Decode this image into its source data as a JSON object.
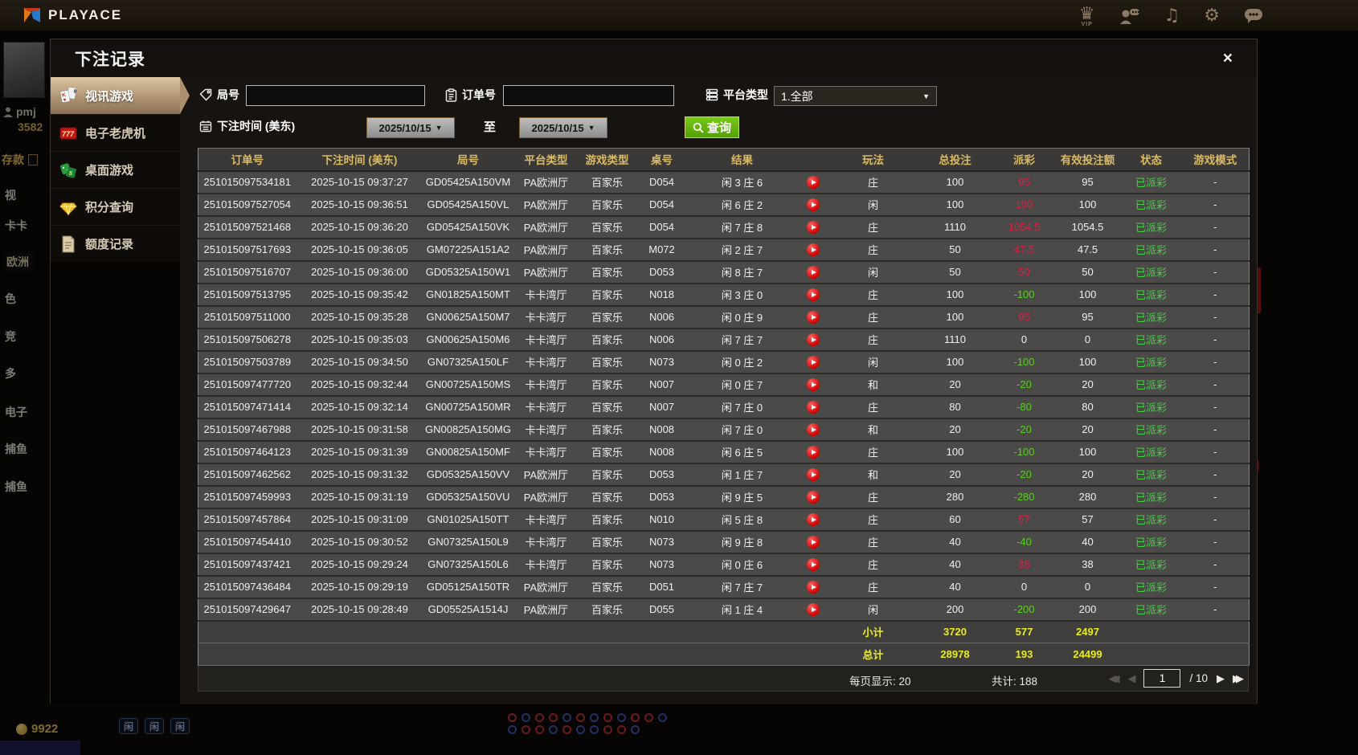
{
  "app": {
    "brand": "PLAYACE"
  },
  "modal": {
    "title": "下注记录",
    "close_glyph": "×"
  },
  "sidebar": {
    "items": [
      {
        "label": "视讯游戏",
        "active": true
      },
      {
        "label": "电子老虎机",
        "active": false
      },
      {
        "label": "桌面游戏",
        "active": false
      },
      {
        "label": "积分查询",
        "active": false
      },
      {
        "label": "额度记录",
        "active": false
      }
    ]
  },
  "filters": {
    "round_label": "局号",
    "round_value": "",
    "order_label": "订单号",
    "order_value": "",
    "platform_label": "平台类型",
    "platform_value": "1.全部",
    "time_label": "下注时间 (美东)",
    "date_from": "2025/10/15",
    "to_label": "至",
    "date_to": "2025/10/15",
    "query_label": "查询",
    "caret": "▼"
  },
  "table": {
    "headers": [
      "订单号",
      "下注时间 (美东)",
      "局号",
      "平台类型",
      "游戏类型",
      "桌号",
      "结果",
      "",
      "玩法",
      "总投注",
      "派彩",
      "有效投注额",
      "状态",
      "游戏模式"
    ],
    "rows": [
      {
        "order": "251015097534181",
        "time": "2025-10-15 09:37:27",
        "round": "GD05425A150VM",
        "platform": "PA欧洲厅",
        "game": "百家乐",
        "table": "D054",
        "result": "闲 3 庄 6",
        "play": "庄",
        "bet": "100",
        "payout": "95",
        "payout_sign": "pos",
        "valid": "95",
        "status": "已派彩",
        "mode": "-"
      },
      {
        "order": "251015097527054",
        "time": "2025-10-15 09:36:51",
        "round": "GD05425A150VL",
        "platform": "PA欧洲厅",
        "game": "百家乐",
        "table": "D054",
        "result": "闲 6 庄 2",
        "play": "闲",
        "bet": "100",
        "payout": "100",
        "payout_sign": "pos",
        "valid": "100",
        "status": "已派彩",
        "mode": "-"
      },
      {
        "order": "251015097521468",
        "time": "2025-10-15 09:36:20",
        "round": "GD05425A150VK",
        "platform": "PA欧洲厅",
        "game": "百家乐",
        "table": "D054",
        "result": "闲 7 庄 8",
        "play": "庄",
        "bet": "1110",
        "payout": "1054.5",
        "payout_sign": "pos",
        "valid": "1054.5",
        "status": "已派彩",
        "mode": "-"
      },
      {
        "order": "251015097517693",
        "time": "2025-10-15 09:36:05",
        "round": "GM07225A151A2",
        "platform": "PA欧洲厅",
        "game": "百家乐",
        "table": "M072",
        "result": "闲 2 庄 7",
        "play": "庄",
        "bet": "50",
        "payout": "47.5",
        "payout_sign": "pos",
        "valid": "47.5",
        "status": "已派彩",
        "mode": "-"
      },
      {
        "order": "251015097516707",
        "time": "2025-10-15 09:36:00",
        "round": "GD05325A150W1",
        "platform": "PA欧洲厅",
        "game": "百家乐",
        "table": "D053",
        "result": "闲 8 庄 7",
        "play": "闲",
        "bet": "50",
        "payout": "50",
        "payout_sign": "pos",
        "valid": "50",
        "status": "已派彩",
        "mode": "-"
      },
      {
        "order": "251015097513795",
        "time": "2025-10-15 09:35:42",
        "round": "GN01825A150MT",
        "platform": "卡卡湾厅",
        "game": "百家乐",
        "table": "N018",
        "result": "闲 3 庄 0",
        "play": "庄",
        "bet": "100",
        "payout": "-100",
        "payout_sign": "neg",
        "valid": "100",
        "status": "已派彩",
        "mode": "-"
      },
      {
        "order": "251015097511000",
        "time": "2025-10-15 09:35:28",
        "round": "GN00625A150M7",
        "platform": "卡卡湾厅",
        "game": "百家乐",
        "table": "N006",
        "result": "闲 0 庄 9",
        "play": "庄",
        "bet": "100",
        "payout": "95",
        "payout_sign": "pos",
        "valid": "95",
        "status": "已派彩",
        "mode": "-"
      },
      {
        "order": "251015097506278",
        "time": "2025-10-15 09:35:03",
        "round": "GN00625A150M6",
        "platform": "卡卡湾厅",
        "game": "百家乐",
        "table": "N006",
        "result": "闲 7 庄 7",
        "play": "庄",
        "bet": "1110",
        "payout": "0",
        "payout_sign": "zero",
        "valid": "0",
        "status": "已派彩",
        "mode": "-"
      },
      {
        "order": "251015097503789",
        "time": "2025-10-15 09:34:50",
        "round": "GN07325A150LF",
        "platform": "卡卡湾厅",
        "game": "百家乐",
        "table": "N073",
        "result": "闲 0 庄 2",
        "play": "闲",
        "bet": "100",
        "payout": "-100",
        "payout_sign": "neg",
        "valid": "100",
        "status": "已派彩",
        "mode": "-"
      },
      {
        "order": "251015097477720",
        "time": "2025-10-15 09:32:44",
        "round": "GN00725A150MS",
        "platform": "卡卡湾厅",
        "game": "百家乐",
        "table": "N007",
        "result": "闲 0 庄 7",
        "play": "和",
        "bet": "20",
        "payout": "-20",
        "payout_sign": "neg",
        "valid": "20",
        "status": "已派彩",
        "mode": "-"
      },
      {
        "order": "251015097471414",
        "time": "2025-10-15 09:32:14",
        "round": "GN00725A150MR",
        "platform": "卡卡湾厅",
        "game": "百家乐",
        "table": "N007",
        "result": "闲 7 庄 0",
        "play": "庄",
        "bet": "80",
        "payout": "-80",
        "payout_sign": "neg",
        "valid": "80",
        "status": "已派彩",
        "mode": "-"
      },
      {
        "order": "251015097467988",
        "time": "2025-10-15 09:31:58",
        "round": "GN00825A150MG",
        "platform": "卡卡湾厅",
        "game": "百家乐",
        "table": "N008",
        "result": "闲 7 庄 0",
        "play": "和",
        "bet": "20",
        "payout": "-20",
        "payout_sign": "neg",
        "valid": "20",
        "status": "已派彩",
        "mode": "-"
      },
      {
        "order": "251015097464123",
        "time": "2025-10-15 09:31:39",
        "round": "GN00825A150MF",
        "platform": "卡卡湾厅",
        "game": "百家乐",
        "table": "N008",
        "result": "闲 6 庄 5",
        "play": "庄",
        "bet": "100",
        "payout": "-100",
        "payout_sign": "neg",
        "valid": "100",
        "status": "已派彩",
        "mode": "-"
      },
      {
        "order": "251015097462562",
        "time": "2025-10-15 09:31:32",
        "round": "GD05325A150VV",
        "platform": "PA欧洲厅",
        "game": "百家乐",
        "table": "D053",
        "result": "闲 1 庄 7",
        "play": "和",
        "bet": "20",
        "payout": "-20",
        "payout_sign": "neg",
        "valid": "20",
        "status": "已派彩",
        "mode": "-"
      },
      {
        "order": "251015097459993",
        "time": "2025-10-15 09:31:19",
        "round": "GD05325A150VU",
        "platform": "PA欧洲厅",
        "game": "百家乐",
        "table": "D053",
        "result": "闲 9 庄 5",
        "play": "庄",
        "bet": "280",
        "payout": "-280",
        "payout_sign": "neg",
        "valid": "280",
        "status": "已派彩",
        "mode": "-"
      },
      {
        "order": "251015097457864",
        "time": "2025-10-15 09:31:09",
        "round": "GN01025A150TT",
        "platform": "卡卡湾厅",
        "game": "百家乐",
        "table": "N010",
        "result": "闲 5 庄 8",
        "play": "庄",
        "bet": "60",
        "payout": "57",
        "payout_sign": "pos",
        "valid": "57",
        "status": "已派彩",
        "mode": "-"
      },
      {
        "order": "251015097454410",
        "time": "2025-10-15 09:30:52",
        "round": "GN07325A150L9",
        "platform": "卡卡湾厅",
        "game": "百家乐",
        "table": "N073",
        "result": "闲 9 庄 8",
        "play": "庄",
        "bet": "40",
        "payout": "-40",
        "payout_sign": "neg",
        "valid": "40",
        "status": "已派彩",
        "mode": "-"
      },
      {
        "order": "251015097437421",
        "time": "2025-10-15 09:29:24",
        "round": "GN07325A150L6",
        "platform": "卡卡湾厅",
        "game": "百家乐",
        "table": "N073",
        "result": "闲 0 庄 6",
        "play": "庄",
        "bet": "40",
        "payout": "38",
        "payout_sign": "pos",
        "valid": "38",
        "status": "已派彩",
        "mode": "-"
      },
      {
        "order": "251015097436484",
        "time": "2025-10-15 09:29:19",
        "round": "GD05125A150TR",
        "platform": "PA欧洲厅",
        "game": "百家乐",
        "table": "D051",
        "result": "闲 7 庄 7",
        "play": "庄",
        "bet": "40",
        "payout": "0",
        "payout_sign": "zero",
        "valid": "0",
        "status": "已派彩",
        "mode": "-"
      },
      {
        "order": "251015097429647",
        "time": "2025-10-15 09:28:49",
        "round": "GD05525A1514J",
        "platform": "PA欧洲厅",
        "game": "百家乐",
        "table": "D055",
        "result": "闲 1 庄 4",
        "play": "闲",
        "bet": "200",
        "payout": "-200",
        "payout_sign": "neg",
        "valid": "200",
        "status": "已派彩",
        "mode": "-"
      }
    ],
    "subtotal": {
      "label": "小计",
      "total_bet": "3720",
      "payout": "577",
      "valid_bet": "2497"
    },
    "grand_total": {
      "label": "总计",
      "total_bet": "28978",
      "payout": "193",
      "valid_bet": "24499"
    }
  },
  "pagination": {
    "per_page_label": "每页显示: 20",
    "total_label": "共计: 188",
    "page": "1",
    "total_pages": "/ 10"
  },
  "background": {
    "username": "pmj",
    "balance": "3582",
    "deposit_label": "存款",
    "nav_items": [
      "视",
      "卡卡",
      "欧洲",
      "色",
      "竞",
      "多",
      "电子",
      "捕鱼",
      "捕鱼"
    ],
    "coins": "9922",
    "bottom_tags": [
      "闲",
      "闲",
      "闲"
    ],
    "beads": [
      [
        "red",
        "blue",
        "red",
        "red",
        "blue",
        "red",
        "blue",
        "red",
        "blue",
        "red",
        "red",
        "blue"
      ],
      [
        "blue",
        "red",
        "red",
        "blue",
        "red",
        "blue",
        "blue",
        "red",
        "red",
        "blue"
      ]
    ]
  },
  "colors": {
    "payout_positive": "#d22443",
    "payout_negative": "#55d41c",
    "status_settled": "#3dd43d",
    "totals_yellow": "#e9ee18",
    "header_gold": "#d9b964",
    "query_green": "#61b40e",
    "active_tab_tan": "#c9ae87"
  }
}
